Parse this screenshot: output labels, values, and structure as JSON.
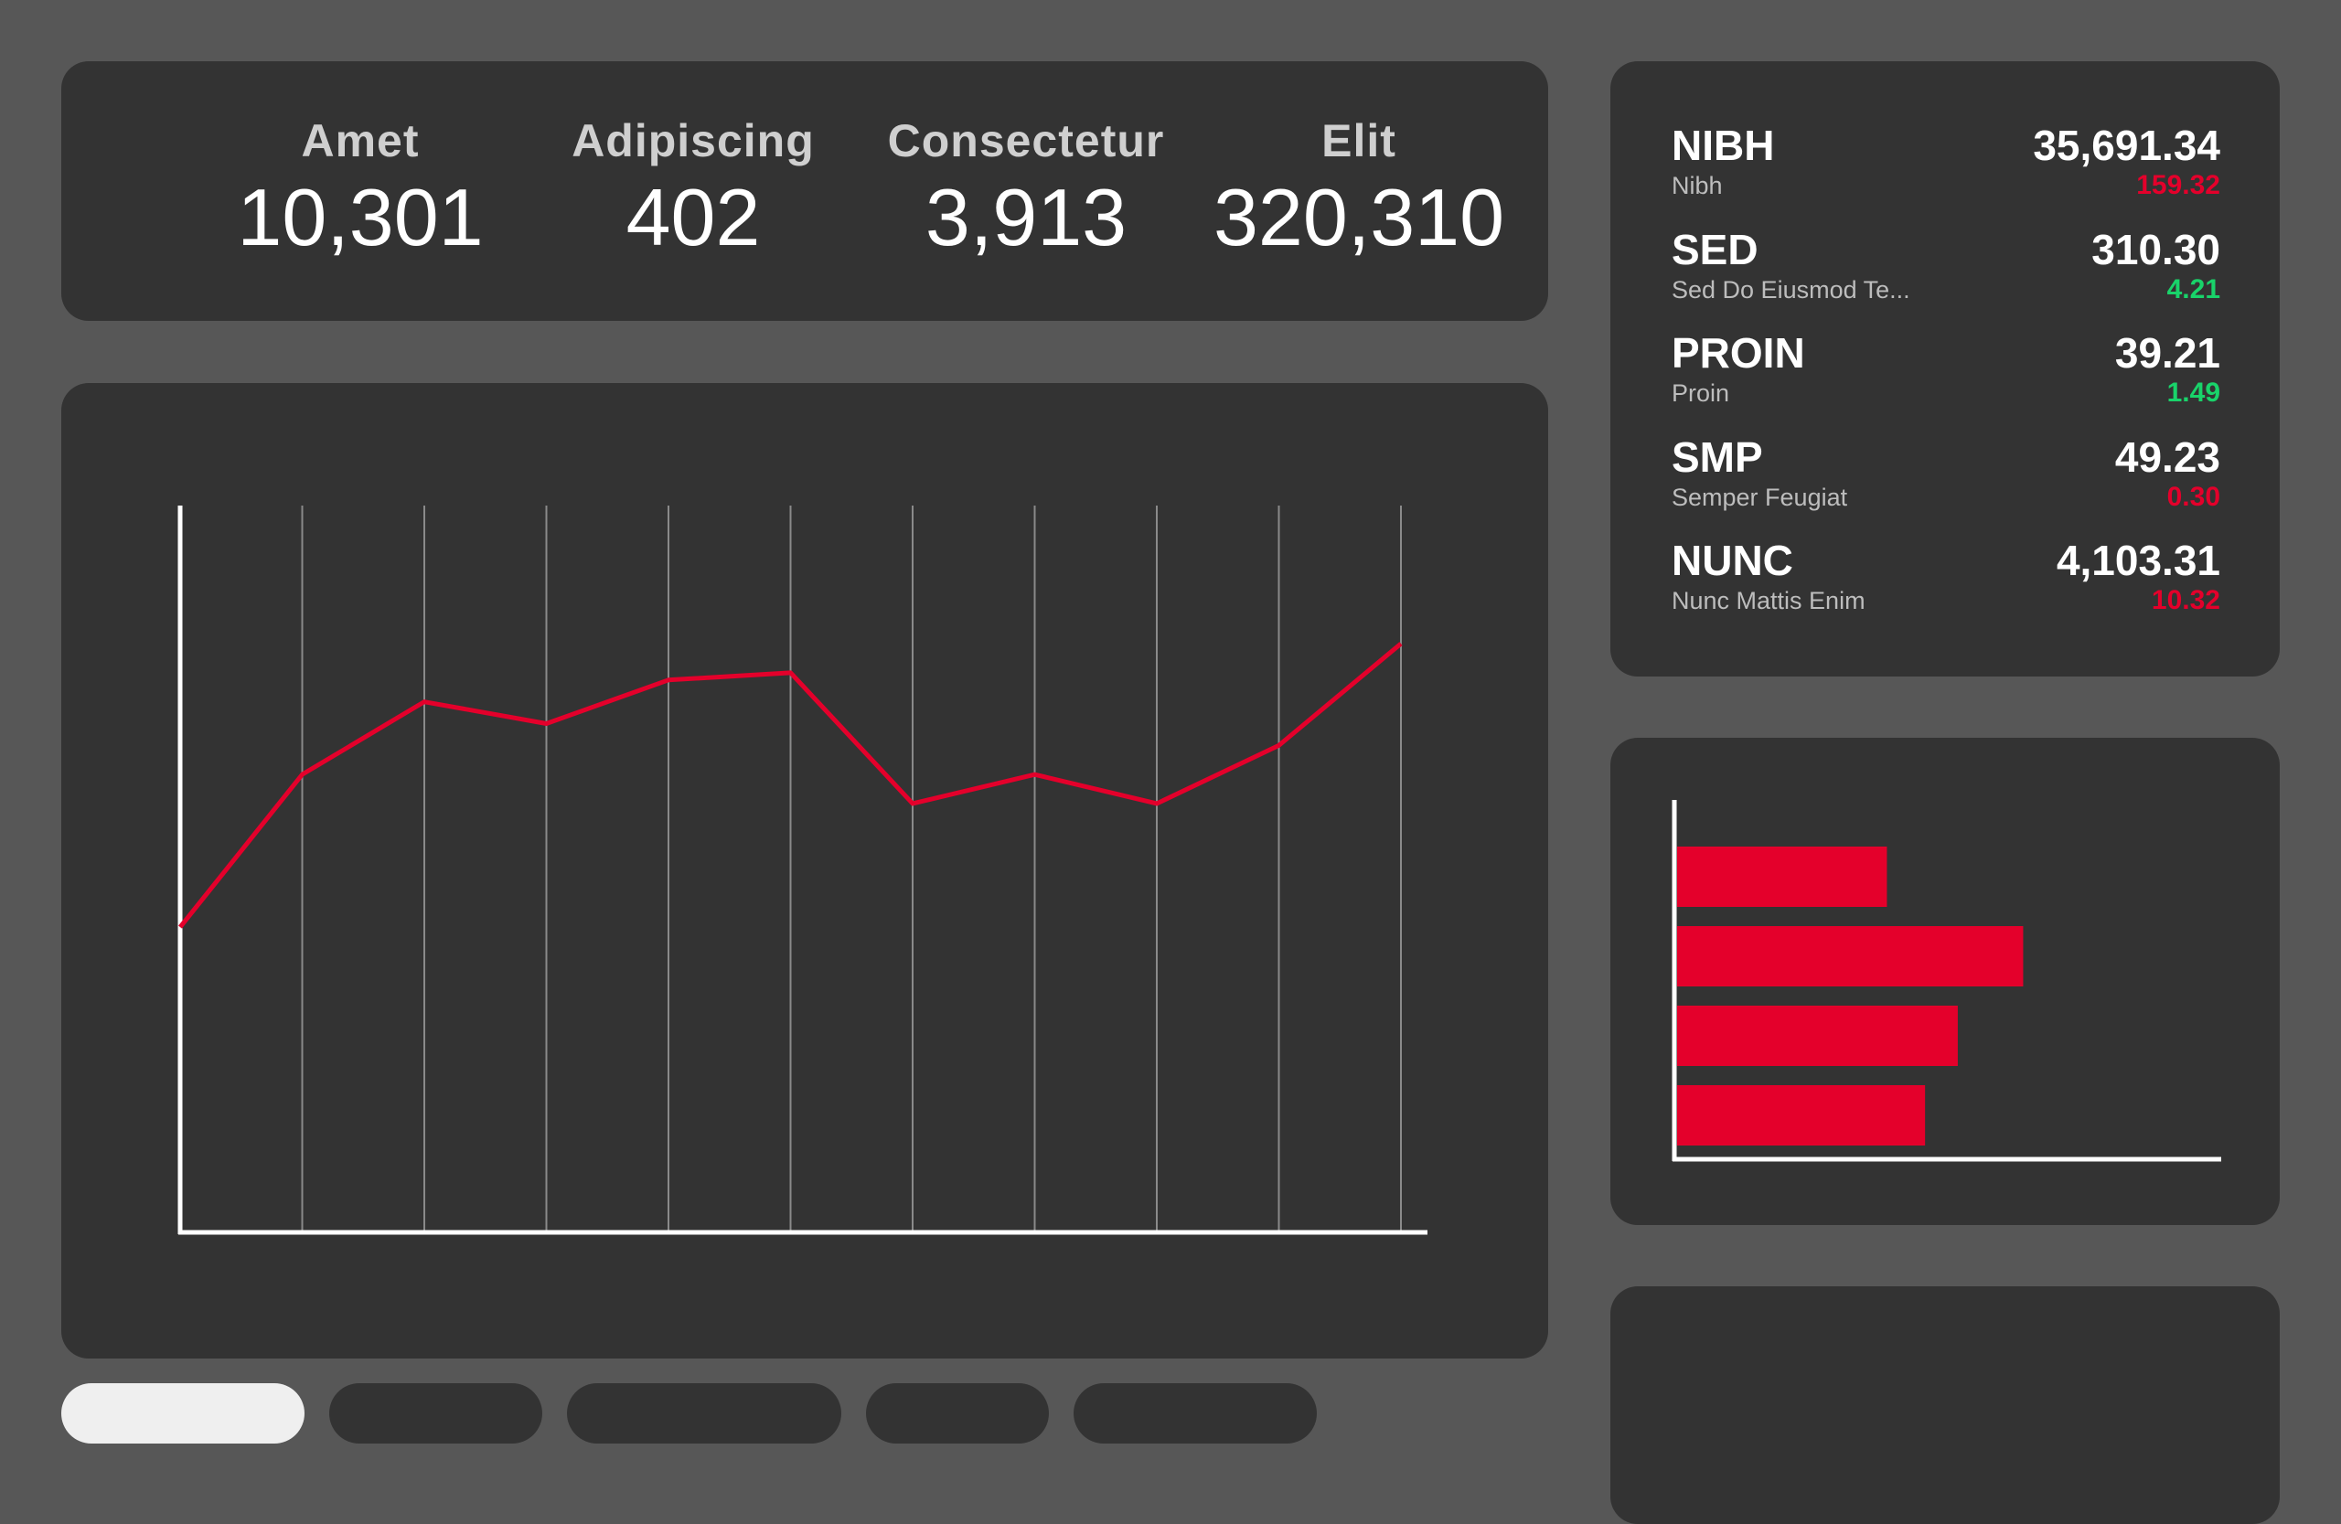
{
  "stats": [
    {
      "label": "Amet",
      "value": "10,301"
    },
    {
      "label": "Adipiscing",
      "value": "402"
    },
    {
      "label": "Consectetur",
      "value": "3,913"
    },
    {
      "label": "Elit",
      "value": "320,310"
    }
  ],
  "tickers": [
    {
      "symbol": "NIBH",
      "name": "Nibh",
      "price": "35,691.34",
      "change": "159.32",
      "direction": "down"
    },
    {
      "symbol": "SED",
      "name": "Sed Do Eiusmod Te...",
      "price": "310.30",
      "change": "4.21",
      "direction": "up"
    },
    {
      "symbol": "PROIN",
      "name": "Proin",
      "price": "39.21",
      "change": "1.49",
      "direction": "up"
    },
    {
      "symbol": "SMP",
      "name": "Semper Feugiat",
      "price": "49.23",
      "change": "0.30",
      "direction": "down"
    },
    {
      "symbol": "NUNC",
      "name": "Nunc Mattis Enim",
      "price": "4,103.31",
      "change": "10.32",
      "direction": "down"
    }
  ],
  "colors": {
    "background": "#575757",
    "panel": "#333333",
    "accent": "#e4002b",
    "positive": "#19d36a",
    "negative": "#e4002b",
    "active_pill": "#efefef"
  },
  "tabs": [
    {
      "active": true
    },
    {
      "active": false
    },
    {
      "active": false
    },
    {
      "active": false
    },
    {
      "active": false
    }
  ],
  "chart_data": [
    {
      "type": "line",
      "x": [
        0,
        1,
        2,
        3,
        4,
        5,
        6,
        7,
        8,
        9,
        10
      ],
      "series": [
        {
          "values": [
            42,
            63,
            73,
            70,
            76,
            77,
            59,
            63,
            59,
            67,
            81
          ]
        }
      ],
      "ylim": [
        0,
        100
      ],
      "grid": "vertical",
      "legend": "none"
    },
    {
      "type": "bar",
      "orientation": "horizontal",
      "categories": [
        "",
        "",
        "",
        ""
      ],
      "values": [
        39,
        64,
        52,
        46
      ],
      "xlim": [
        0,
        100
      ],
      "legend": "none"
    }
  ]
}
